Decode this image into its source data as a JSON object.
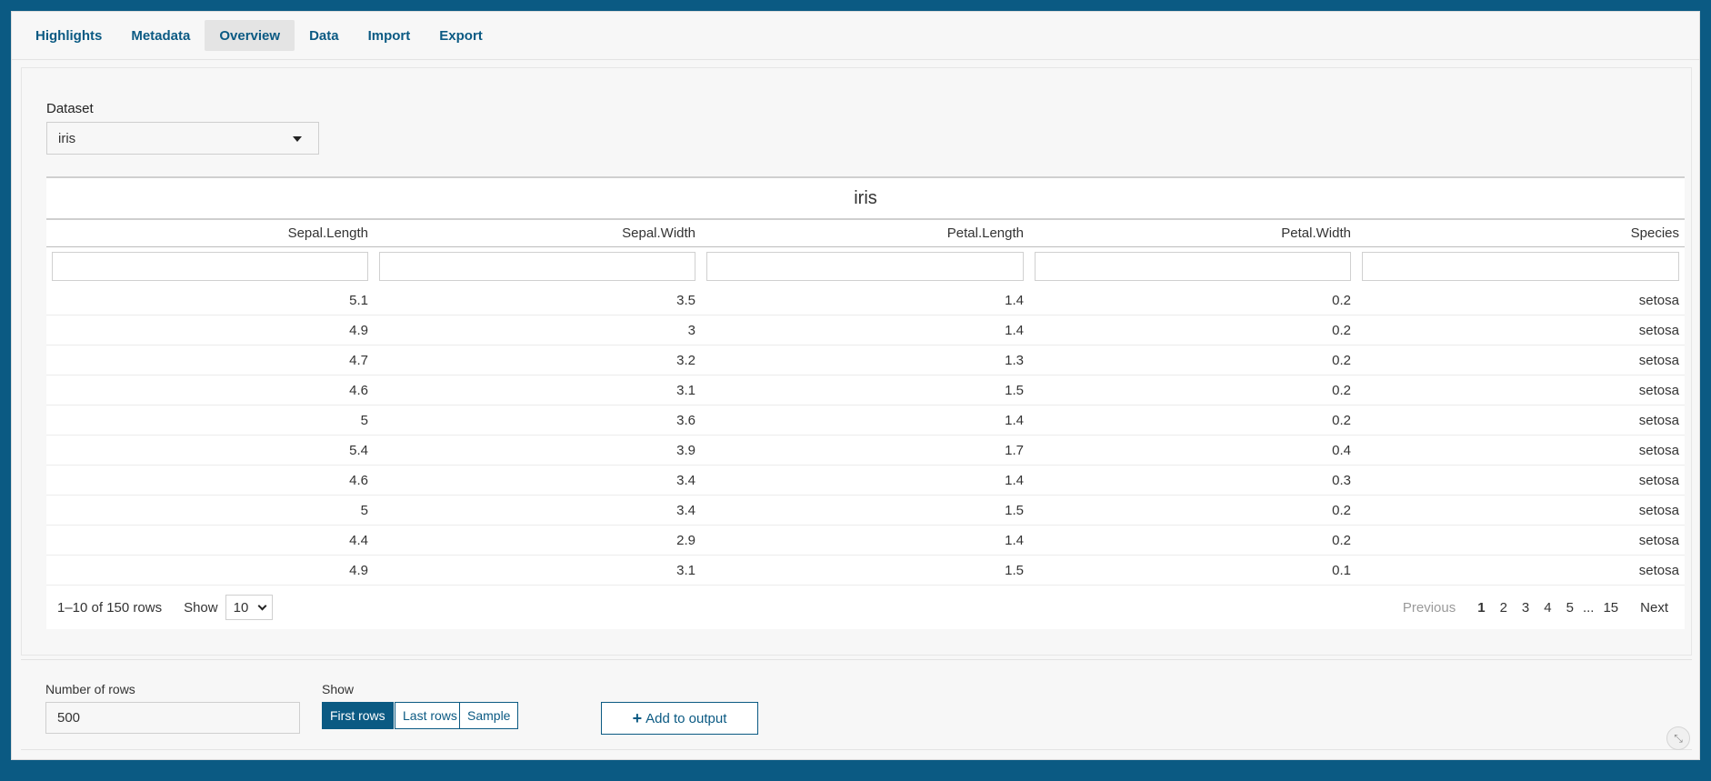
{
  "nav": {
    "tabs": [
      {
        "label": "Highlights"
      },
      {
        "label": "Metadata"
      },
      {
        "label": "Overview"
      },
      {
        "label": "Data"
      },
      {
        "label": "Import"
      },
      {
        "label": "Export"
      }
    ],
    "active_tab": "Overview"
  },
  "dataset": {
    "label": "Dataset",
    "selected": "iris"
  },
  "table": {
    "title": "iris",
    "columns": [
      "Sepal.Length",
      "Sepal.Width",
      "Petal.Length",
      "Petal.Width",
      "Species"
    ],
    "rows": [
      [
        "5.1",
        "3.5",
        "1.4",
        "0.2",
        "setosa"
      ],
      [
        "4.9",
        "3",
        "1.4",
        "0.2",
        "setosa"
      ],
      [
        "4.7",
        "3.2",
        "1.3",
        "0.2",
        "setosa"
      ],
      [
        "4.6",
        "3.1",
        "1.5",
        "0.2",
        "setosa"
      ],
      [
        "5",
        "3.6",
        "1.4",
        "0.2",
        "setosa"
      ],
      [
        "5.4",
        "3.9",
        "1.7",
        "0.4",
        "setosa"
      ],
      [
        "4.6",
        "3.4",
        "1.4",
        "0.3",
        "setosa"
      ],
      [
        "5",
        "3.4",
        "1.5",
        "0.2",
        "setosa"
      ],
      [
        "4.4",
        "2.9",
        "1.4",
        "0.2",
        "setosa"
      ],
      [
        "4.9",
        "3.1",
        "1.5",
        "0.1",
        "setosa"
      ]
    ],
    "footer": {
      "rows_info": "1–10 of 150 rows",
      "show_label": "Show",
      "page_size": "10",
      "pager": {
        "previous": "Previous",
        "pages": [
          "1",
          "2",
          "3",
          "4",
          "5"
        ],
        "ellipsis": "...",
        "last": "15",
        "next": "Next",
        "current": "1"
      }
    }
  },
  "controls": {
    "nrows_label": "Number of rows",
    "nrows_value": "500",
    "show_label": "Show",
    "buttons": {
      "first": "First rows",
      "last": "Last rows",
      "sample": "Sample"
    },
    "add_output": "Add to output"
  },
  "colors": {
    "accent": "#0b5a83",
    "background": "#f7f7f7"
  }
}
